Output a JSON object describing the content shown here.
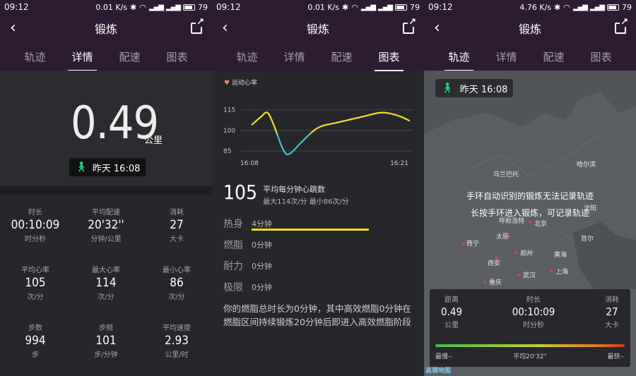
{
  "status_bars": [
    {
      "time": "09:12",
      "net": "0.01 K/s",
      "battery": "79"
    },
    {
      "time": "09:12",
      "net": "0.01 K/s",
      "battery": "79"
    },
    {
      "time": "09:12",
      "net": "4.76 K/s",
      "battery": "79"
    }
  ],
  "nav": {
    "title": "锻炼",
    "back_icon": "chevron-left-icon",
    "share_icon": "share-icon"
  },
  "tabs": [
    "轨迹",
    "详情",
    "配速",
    "图表"
  ],
  "details": {
    "distance": "0.49",
    "distance_unit": "公里",
    "time_chip": "昨天 16:08",
    "stats": [
      {
        "label": "时长",
        "value": "00:10:09",
        "unit": "时分秒"
      },
      {
        "label": "平均配速",
        "value": "20'32''",
        "unit": "分钟/公里"
      },
      {
        "label": "消耗",
        "value": "27",
        "unit": "大卡"
      },
      {
        "label": "平均心率",
        "value": "105",
        "unit": "次/分"
      },
      {
        "label": "最大心率",
        "value": "114",
        "unit": "次/分"
      },
      {
        "label": "最小心率",
        "value": "86",
        "unit": "次/分"
      },
      {
        "label": "步数",
        "value": "994",
        "unit": "步"
      },
      {
        "label": "步频",
        "value": "101",
        "unit": "步/分钟"
      },
      {
        "label": "平均速度",
        "value": "2.93",
        "unit": "公里/时"
      }
    ]
  },
  "chart_screen": {
    "hr_title": "运动心率",
    "avg_hr": "105",
    "avg_title": "平均每分钟心跳数",
    "avg_sub": "最大114次/分   最小86次/分",
    "zones": [
      {
        "name": "热身",
        "value": "4分钟",
        "minutes": 4
      },
      {
        "name": "燃脂",
        "value": "0分钟",
        "minutes": 0
      },
      {
        "name": "耐力",
        "value": "0分钟",
        "minutes": 0
      },
      {
        "name": "极限",
        "value": "0分钟",
        "minutes": 0
      }
    ],
    "note": "你的燃脂总时长为0分钟，其中高效燃脂0分钟在燃脂区间持续锻炼20分钟后即进入高效燃脂阶段"
  },
  "chart_data": {
    "type": "line",
    "title": "运动心率",
    "x_labels": [
      "16:08",
      "16:21"
    ],
    "y_ticks": [
      115,
      100,
      85
    ],
    "ylim": [
      82,
      120
    ],
    "series": [
      {
        "values": [
          {
            "t": 0.0,
            "hr": 104
          },
          {
            "t": 0.06,
            "hr": 110
          },
          {
            "t": 0.1,
            "hr": 113
          },
          {
            "t": 0.14,
            "hr": 104
          },
          {
            "t": 0.2,
            "hr": 86
          },
          {
            "t": 0.24,
            "hr": 83
          },
          {
            "t": 0.32,
            "hr": 92
          },
          {
            "t": 0.42,
            "hr": 102
          },
          {
            "t": 0.55,
            "hr": 106
          },
          {
            "t": 0.7,
            "hr": 110
          },
          {
            "t": 0.82,
            "hr": 113
          },
          {
            "t": 0.92,
            "hr": 111
          },
          {
            "t": 1.0,
            "hr": 107
          }
        ]
      }
    ],
    "colors": [
      "#f3dc26",
      "#3fc4d6"
    ],
    "grid": true
  },
  "map_screen": {
    "time_chip": "昨天 16:08",
    "message_line1": "手环自动识别的锻炼无法记录轨迹",
    "message_line2": "长按手环进入锻炼，可记录轨迹",
    "cities": [
      {
        "name": "乌兰巴托"
      },
      {
        "name": "哈尔滨"
      },
      {
        "name": "呼和浩特"
      },
      {
        "name": "北京"
      },
      {
        "name": "沈阳"
      },
      {
        "name": "太原"
      },
      {
        "name": "首尔"
      },
      {
        "name": "西宁"
      },
      {
        "name": "郑州"
      },
      {
        "name": "黄海"
      },
      {
        "name": "西安"
      },
      {
        "name": "武汉"
      },
      {
        "name": "上海"
      },
      {
        "name": "重庆"
      }
    ],
    "panel_stats": [
      {
        "label": "距离",
        "value": "0.49",
        "unit": "公里"
      },
      {
        "label": "时长",
        "value": "00:10:09",
        "unit": "时分秒"
      },
      {
        "label": "消耗",
        "value": "27",
        "unit": "大卡"
      }
    ],
    "speed_slow": "最慢--",
    "speed_avg": "平均20'32\"",
    "speed_fast": "最快--",
    "logo": "高德地图"
  }
}
